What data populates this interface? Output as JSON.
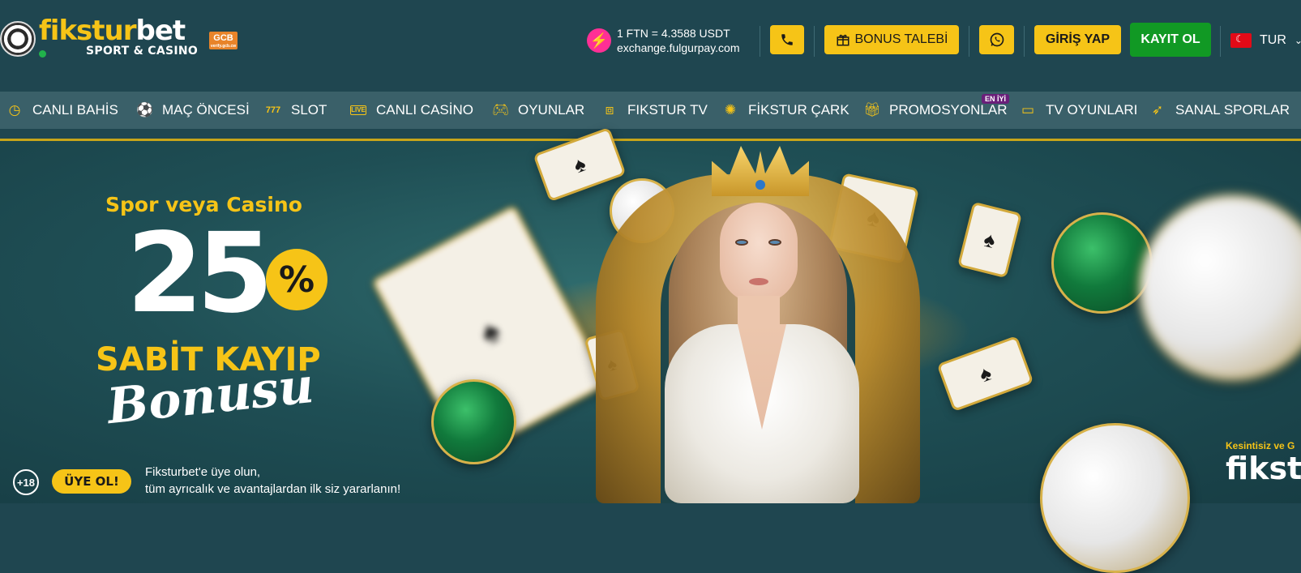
{
  "header": {
    "logo_main_a": "fikstur",
    "logo_main_b": "bet",
    "logo_sub": "SPORT & CASINO",
    "license_badge": "GCB",
    "license_badge_small": "verify.gcb.cw",
    "rate_line1": "1 FTN = 4.3588 USDT",
    "rate_line2": "exchange.fulgurpay.com",
    "bonus_label": "BONUS TALEBİ",
    "login_label": "GİRİŞ YAP",
    "signup_label": "KAYIT OL",
    "language": "TUR"
  },
  "nav": {
    "items": [
      {
        "label": "CANLI BAHİS",
        "icon": "clock-icon"
      },
      {
        "label": "MAÇ ÖNCESİ",
        "icon": "football-icon"
      },
      {
        "label": "SLOT",
        "icon": "slot-777-icon"
      },
      {
        "label": "CANLI CASİNO",
        "icon": "live-icon"
      },
      {
        "label": "OYUNLAR",
        "icon": "gamepad-icon"
      },
      {
        "label": "FIKSTUR TV",
        "icon": "tv-antenna-icon"
      },
      {
        "label": "FİKSTUR ÇARK",
        "icon": "wheel-icon"
      },
      {
        "label": "PROMOSYONLAR",
        "icon": "gift-icon"
      },
      {
        "label": "TV OYUNLARI",
        "icon": "monitor-icon"
      },
      {
        "label": "SANAL SPORLAR",
        "icon": "virtual-sports-icon"
      }
    ],
    "promo_badge": "EN İYİ"
  },
  "banner": {
    "subtitle": "Spor veya Casino",
    "big_number": "25",
    "percent": "%",
    "line": "SABİT KAYIP",
    "script": "Bonusu",
    "age": "+18",
    "cta": "ÜYE OL!",
    "cta_text_1": "Fiksturbet'e  üye olun,",
    "cta_text_2": "tüm ayrıcalık ve avantajlardan ilk siz yararlanın!",
    "corner_sub": "Kesintisiz ve G",
    "corner_logo": "fikst"
  },
  "colors": {
    "header_bg": "#1f4650",
    "nav_bg": "#3a6069",
    "accent_yellow": "#f6c417",
    "signup_green": "#119924",
    "rate_pink": "#ff2f95"
  }
}
